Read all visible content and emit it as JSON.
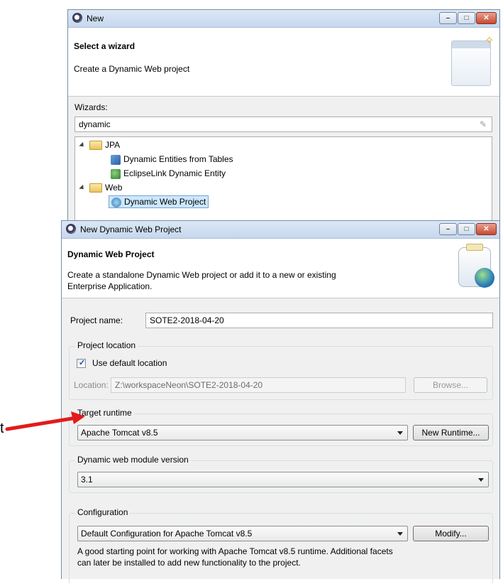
{
  "colors": {
    "arrow": "#e21b1b",
    "selection": "#cce8ff",
    "accent": "#2a4d8f"
  },
  "new_wizard": {
    "title": "New",
    "banner_title": "Select a wizard",
    "banner_desc": "Create a Dynamic Web project",
    "wizards_label": "Wizards:",
    "filter_value": "dynamic",
    "tree": [
      {
        "label": "JPA",
        "type": "folder",
        "level": 0
      },
      {
        "label": "Dynamic Entities from Tables",
        "type": "entities",
        "level": 1
      },
      {
        "label": "EclipseLink Dynamic Entity",
        "type": "eclipselink",
        "level": 1
      },
      {
        "label": "Web",
        "type": "folder",
        "level": 0
      },
      {
        "label": "Dynamic Web Project",
        "type": "web",
        "level": 1,
        "selected": true
      }
    ]
  },
  "dwp": {
    "title": "New Dynamic Web Project",
    "banner_title": "Dynamic Web Project",
    "banner_desc_1": "Create a standalone Dynamic Web project or add it to a new or existing",
    "banner_desc_2": "Enterprise Application.",
    "project_name_label": "Project name:",
    "project_name": "SOTE2-2018-04-20",
    "project_location_group": "Project location",
    "use_default_label": "Use default location",
    "use_default_checked": true,
    "location_label": "Location:",
    "location_value": "Z:\\workspaceNeon\\SOTE2-2018-04-20",
    "browse_label": "Browse...",
    "target_runtime_group": "Target runtime",
    "target_runtime_value": "Apache Tomcat v8.5",
    "new_runtime_label": "New Runtime...",
    "module_version_group": "Dynamic web module version",
    "module_version_value": "3.1",
    "configuration_group": "Configuration",
    "configuration_value": "Default Configuration for Apache Tomcat v8.5",
    "modify_label": "Modify...",
    "config_desc_1": "A good starting point for working with Apache Tomcat v8.5 runtime. Additional facets",
    "config_desc_2": "can later be installed to add new functionality to the project."
  },
  "side_text": "t"
}
